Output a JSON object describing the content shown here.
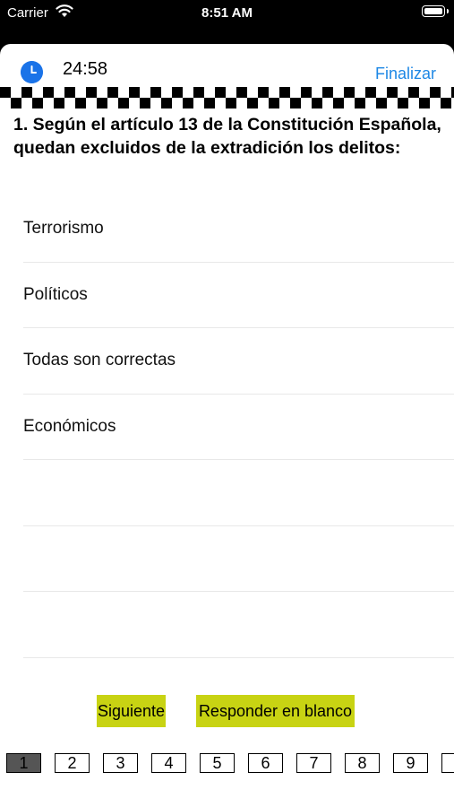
{
  "status_bar": {
    "carrier": "Carrier",
    "time": "8:51 AM"
  },
  "header": {
    "timer": "24:58",
    "finish_label": "Finalizar"
  },
  "question": {
    "text": "1. Según el artículo 13 de la Constitución Española, quedan excluidos de la extradición los delitos:",
    "options": [
      "Terrorismo",
      "Políticos",
      "Todas son correctas",
      "Económicos",
      "",
      "",
      ""
    ]
  },
  "actions": {
    "next_label": "Siguiente",
    "blank_label": "Responder en blanco"
  },
  "pager": {
    "pages": [
      "1",
      "2",
      "3",
      "4",
      "5",
      "6",
      "7",
      "8",
      "9",
      ""
    ],
    "current": "1"
  },
  "colors": {
    "accent": "#1e88e5",
    "button_bg": "#c8d313",
    "clock_icon": "#1a73e8"
  }
}
